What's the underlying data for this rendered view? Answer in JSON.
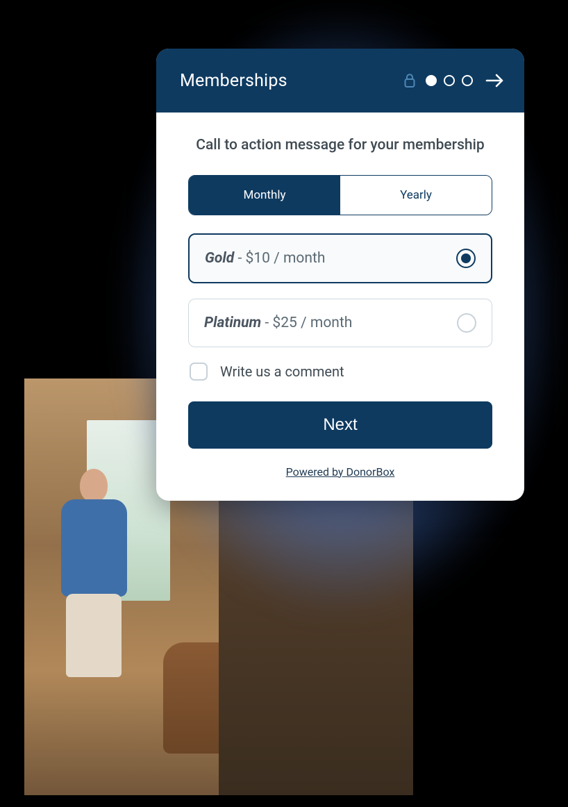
{
  "header": {
    "title": "Memberships",
    "steps_total": 3,
    "current_step": 1
  },
  "cta_message": "Call to action message for your membership",
  "interval_tabs": {
    "monthly": "Monthly",
    "yearly": "Yearly",
    "active": "monthly"
  },
  "plans": [
    {
      "tier": "Gold",
      "price_text": " - $10 / month",
      "selected": true
    },
    {
      "tier": "Platinum",
      "price_text": " - $25 / month",
      "selected": false
    }
  ],
  "comment": {
    "label": "Write us a comment",
    "checked": false
  },
  "next_button": "Next",
  "footer_link": "Powered by DonorBox"
}
